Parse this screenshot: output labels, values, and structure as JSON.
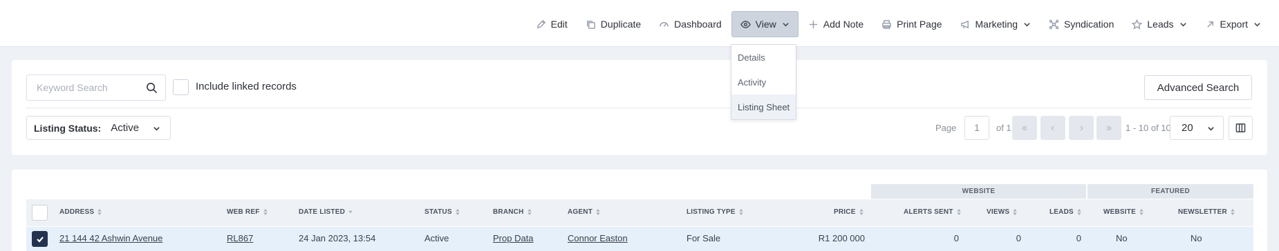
{
  "toolbar": {
    "items": [
      {
        "label": "Edit",
        "icon": "pencil-icon"
      },
      {
        "label": "Duplicate",
        "icon": "copy-icon"
      },
      {
        "label": "Dashboard",
        "icon": "gauge-icon"
      },
      {
        "label": "View",
        "icon": "eye-icon"
      },
      {
        "label": "Add Note",
        "icon": "plus-icon"
      },
      {
        "label": "Print Page",
        "icon": "printer-icon"
      },
      {
        "label": "Marketing",
        "icon": "megaphone-icon"
      },
      {
        "label": "Syndication",
        "icon": "network-icon"
      },
      {
        "label": "Leads",
        "icon": "star-icon"
      },
      {
        "label": "Export",
        "icon": "arrow-up-right-icon"
      }
    ]
  },
  "view_menu": {
    "items": [
      "Details",
      "Activity",
      "Listing Sheet"
    ],
    "highlighted": "Listing Sheet"
  },
  "search": {
    "placeholder": "Keyword Search",
    "include_linked_label": "Include linked records",
    "advanced_label": "Advanced Search"
  },
  "filter": {
    "label": "Listing Status:",
    "value": "Active"
  },
  "pager": {
    "page_label": "Page",
    "page": "1",
    "of_label": "of 1",
    "range_label": "1 - 10 of 10",
    "per_page": "20"
  },
  "table": {
    "groups": {
      "website": "WEBSITE",
      "featured": "FEATURED"
    },
    "columns": {
      "address": "ADDRESS",
      "web_ref": "WEB REF",
      "date_listed": "DATE LISTED",
      "status": "STATUS",
      "branch": "BRANCH",
      "agent": "AGENT",
      "listing_type": "LISTING TYPE",
      "price": "PRICE",
      "alerts_sent": "ALERTS SENT",
      "views": "VIEWS",
      "leads": "LEADS",
      "website": "WEBSITE",
      "newsletter": "NEWSLETTER"
    },
    "rows": [
      {
        "address": "21 144 42 Ashwin Avenue",
        "web_ref": "RL867",
        "date_listed": "24 Jan 2023, 13:54",
        "status": "Active",
        "branch": "Prop Data",
        "agent": "Connor Easton",
        "listing_type": "For Sale",
        "price": "R1 200 000",
        "alerts_sent": "0",
        "views": "0",
        "leads": "0",
        "website": "No",
        "newsletter": "No"
      }
    ]
  }
}
